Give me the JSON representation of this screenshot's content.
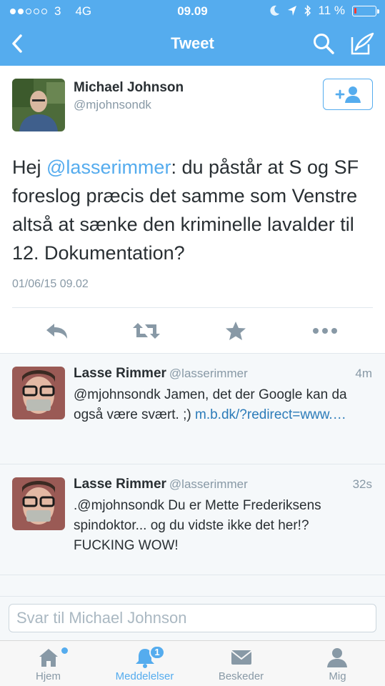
{
  "status_bar": {
    "carrier": "3",
    "network": "4G",
    "time": "09.09",
    "battery": "11 %",
    "battery_level": 0.11
  },
  "nav": {
    "title": "Tweet",
    "icons": [
      "back-icon",
      "search-icon",
      "compose-icon"
    ]
  },
  "tweet": {
    "author_name": "Michael Johnson",
    "author_handle": "@mjohnsondk",
    "text_before": "Hej ",
    "mention": "@lasserimmer",
    "text_after": ": du påstår at S og SF foreslog præcis det samme som Venstre altså at sænke den kriminelle lavalder til 12. Dokumentation?",
    "date": "01/06/15 09.02",
    "actions": [
      "reply-icon",
      "retweet-icon",
      "favorite-icon",
      "more-icon"
    ]
  },
  "replies": [
    {
      "name": "Lasse Rimmer",
      "handle": "@lasserimmer",
      "time": "4m",
      "text": "@mjohnsondk Jamen, det der Google kan da også være svært. ;) ",
      "link": "m.b.dk/?redirect=www.…"
    },
    {
      "name": "Lasse Rimmer",
      "handle": "@lasserimmer",
      "time": "32s",
      "text": ".@mjohnsondk Du er Mette Frederiksens spindoktor... og du vidste ikke det her!? FUCKING WOW!",
      "link": ""
    }
  ],
  "reply_field": {
    "placeholder": "Svar til Michael Johnson",
    "value": ""
  },
  "tabbar": {
    "tabs": [
      {
        "label": "Hjem",
        "icon": "home-icon"
      },
      {
        "label": "Meddelelser",
        "icon": "notifications-icon",
        "badge": "1"
      },
      {
        "label": "Beskeder",
        "icon": "messages-icon"
      },
      {
        "label": "Mig",
        "icon": "profile-icon"
      }
    ],
    "active": "Meddelelser"
  },
  "colors": {
    "brand": "#55acee",
    "link": "#2b7bb9",
    "battery_low": "#ff3b30"
  }
}
